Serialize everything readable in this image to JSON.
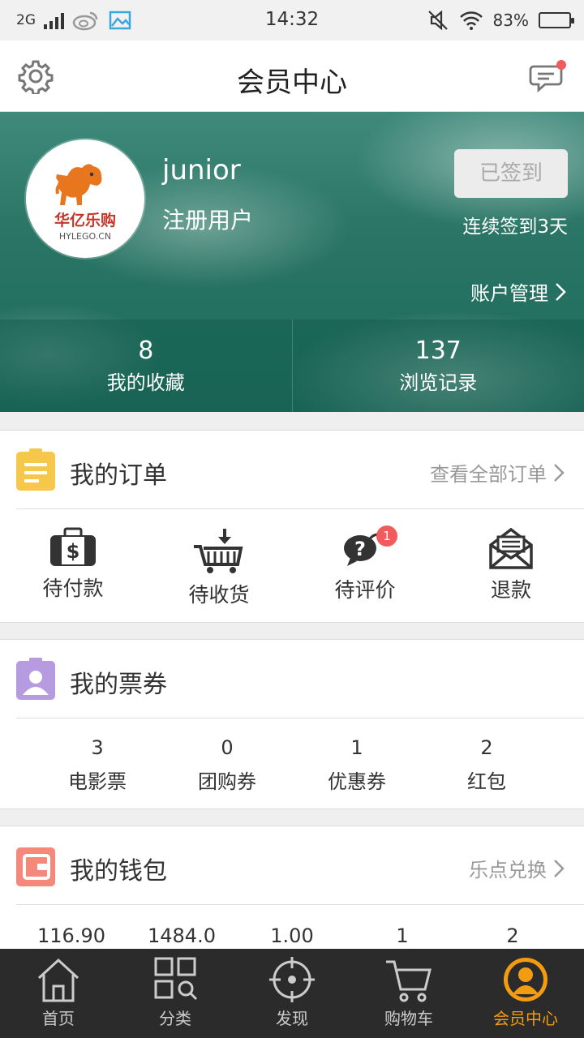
{
  "status_bar": {
    "network": "2G",
    "time": "14:32",
    "battery": "83%",
    "battery_level": 0.83
  },
  "nav": {
    "title": "会员中心"
  },
  "profile": {
    "username": "junior",
    "user_type": "注册用户",
    "logo_text": "华亿乐购",
    "logo_domain": "HYLEGO.CN",
    "checkin_label": "已签到",
    "checkin_streak": "连续签到3天",
    "account_link": "账户管理",
    "stats": [
      {
        "value": "8",
        "label": "我的收藏"
      },
      {
        "value": "137",
        "label": "浏览记录"
      }
    ]
  },
  "orders": {
    "title": "我的订单",
    "link": "查看全部订单",
    "items": [
      {
        "label": "待付款",
        "icon": "wallet-dollar-icon"
      },
      {
        "label": "待收货",
        "icon": "cart-download-icon"
      },
      {
        "label": "待评价",
        "icon": "question-chat-icon",
        "badge": "1"
      },
      {
        "label": "退款",
        "icon": "envelope-icon"
      }
    ]
  },
  "tickets": {
    "title": "我的票券",
    "items": [
      {
        "value": "3",
        "label": "电影票"
      },
      {
        "value": "0",
        "label": "团购券"
      },
      {
        "value": "1",
        "label": "优惠券"
      },
      {
        "value": "2",
        "label": "红包"
      }
    ]
  },
  "wallet": {
    "title": "我的钱包",
    "link": "乐点兑换",
    "values": [
      "116.90",
      "1484.0",
      "1.00",
      "1",
      "2"
    ]
  },
  "tabs": [
    {
      "label": "首页",
      "icon": "home-icon"
    },
    {
      "label": "分类",
      "icon": "category-icon"
    },
    {
      "label": "发现",
      "icon": "crosshair-icon"
    },
    {
      "label": "购物车",
      "icon": "cart-icon"
    },
    {
      "label": "会员中心",
      "icon": "member-icon",
      "active": true
    }
  ],
  "colors": {
    "accent": "#f39c12",
    "hero": "#2a7565",
    "badge": "#f15b5b",
    "orders_icon": "#f5c84c",
    "tickets_icon": "#b79be0",
    "wallet_icon": "#f4887a"
  }
}
